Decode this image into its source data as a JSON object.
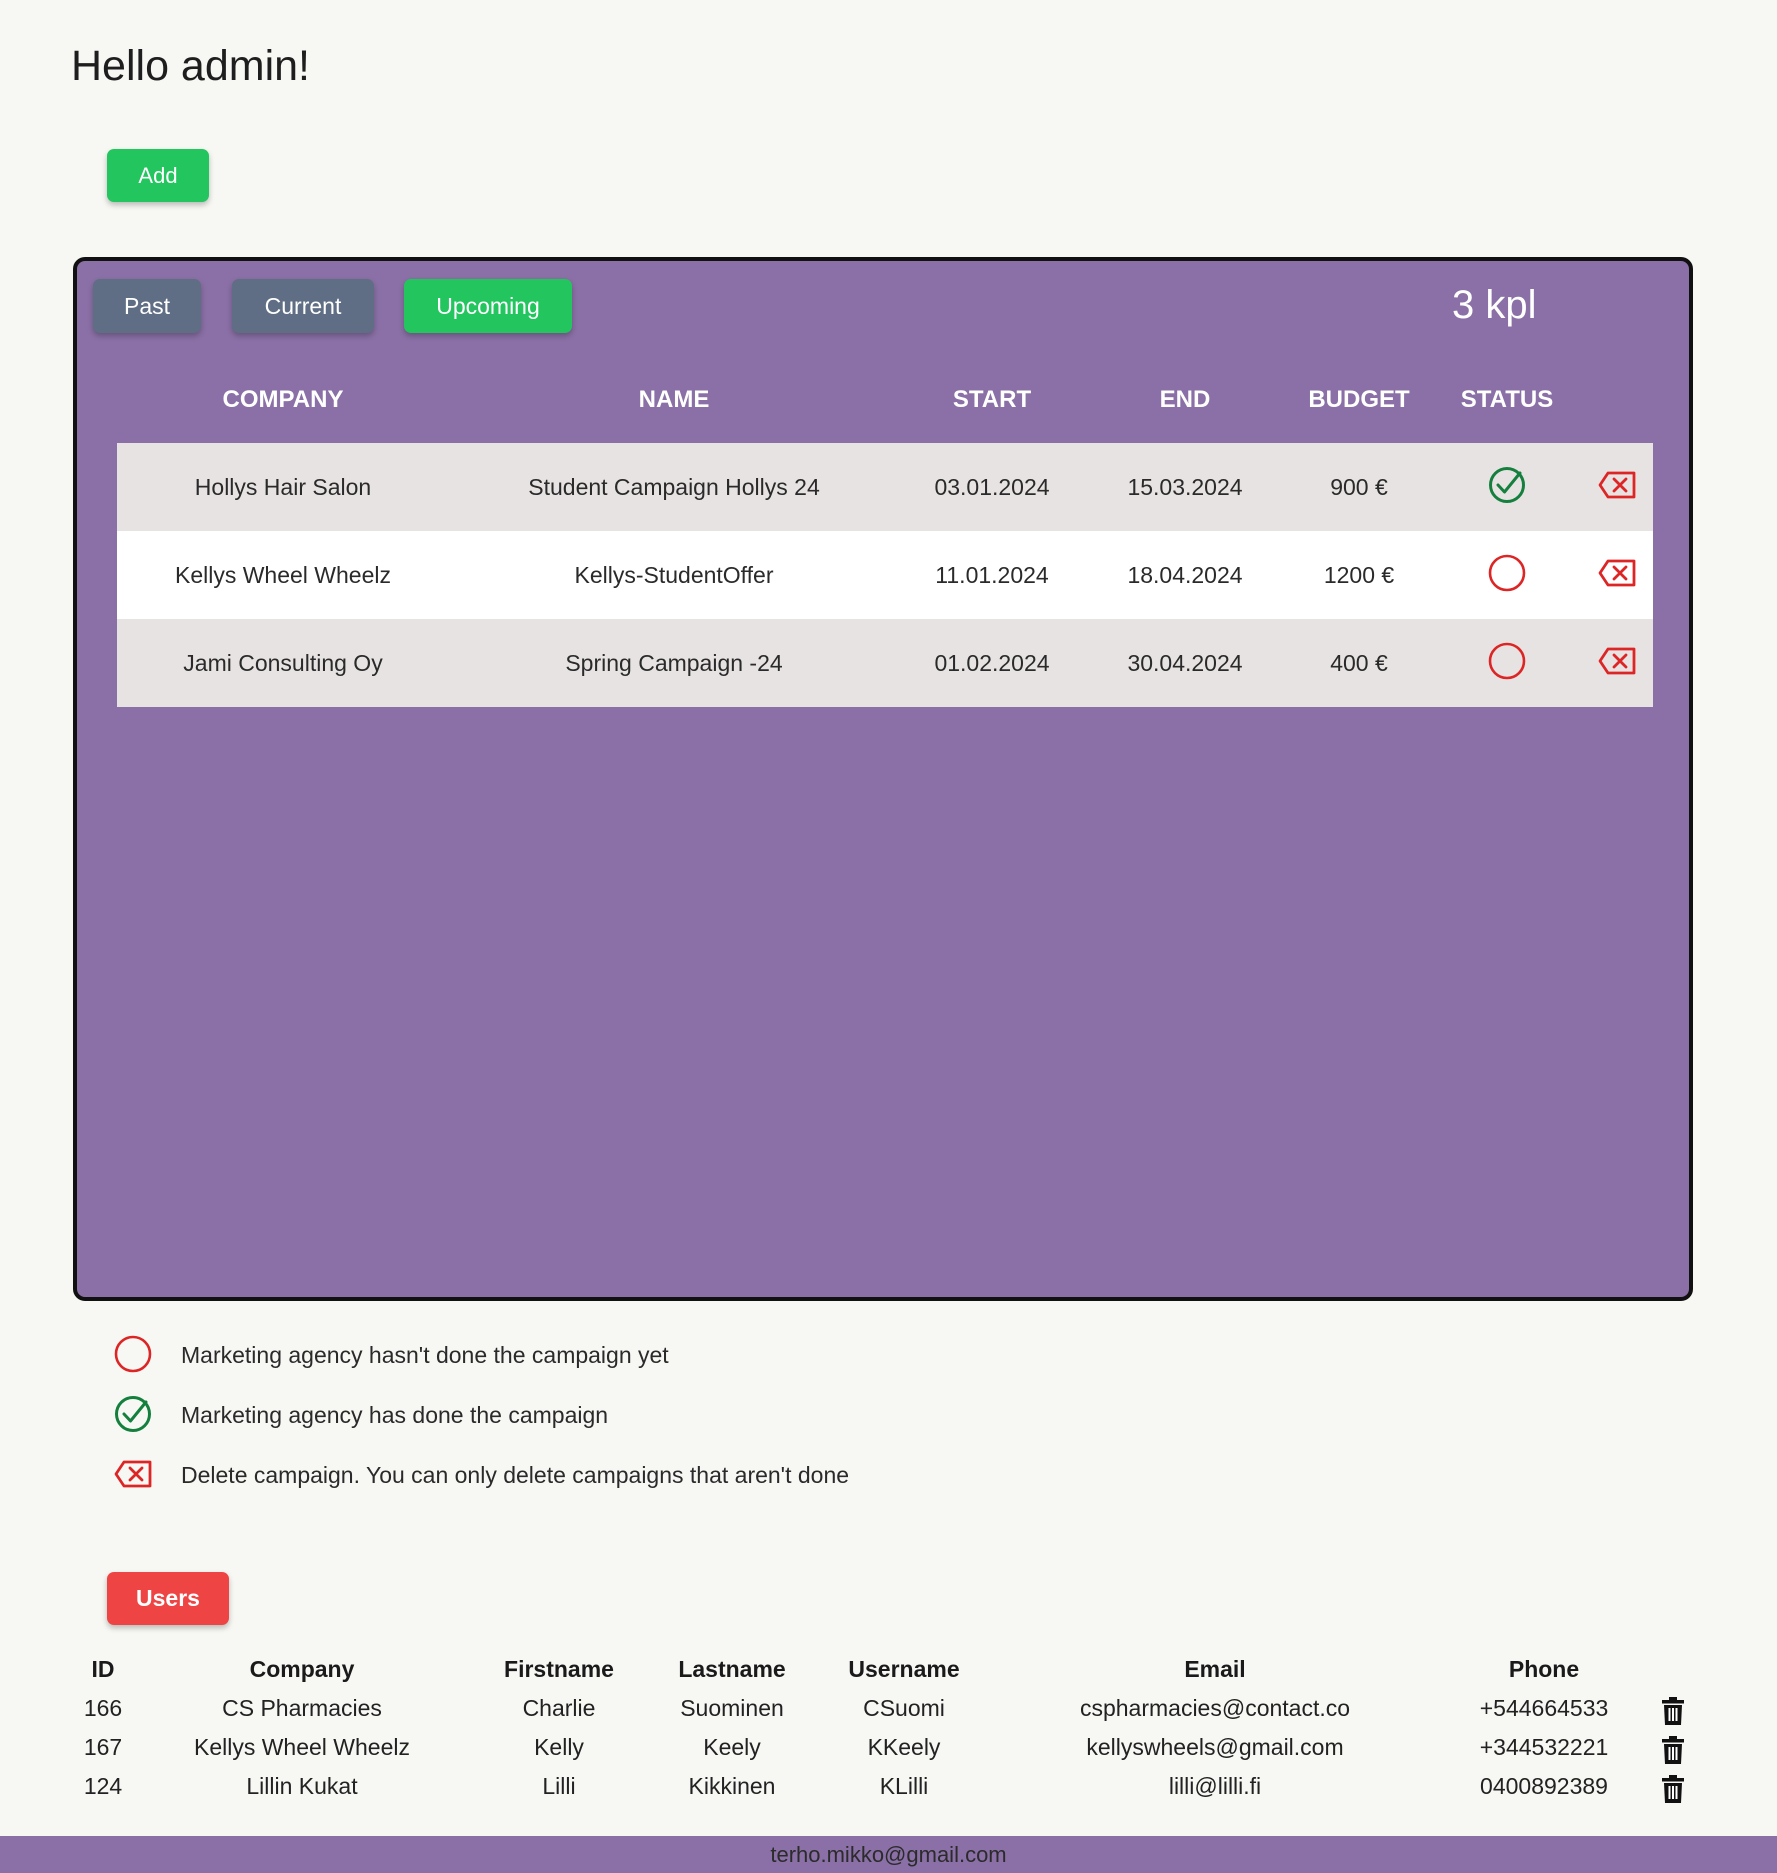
{
  "greeting": "Hello admin!",
  "add_button": "Add",
  "tabs": {
    "past": "Past",
    "current": "Current",
    "upcoming": "Upcoming",
    "active": "upcoming"
  },
  "count": "3 kpl",
  "campaign_headers": {
    "company": "COMPANY",
    "name": "NAME",
    "start": "START",
    "end": "END",
    "budget": "BUDGET",
    "status": "STATUS"
  },
  "campaigns": [
    {
      "company": "Hollys Hair Salon",
      "name": "Student Campaign Hollys 24",
      "start": "03.01.2024",
      "end": "15.03.2024",
      "budget": "900 €",
      "status": "done"
    },
    {
      "company": "Kellys Wheel Wheelz",
      "name": "Kellys-StudentOffer",
      "start": "11.01.2024",
      "end": "18.04.2024",
      "budget": "1200 €",
      "status": "not-done"
    },
    {
      "company": "Jami Consulting Oy",
      "name": "Spring Campaign -24",
      "start": "01.02.2024",
      "end": "30.04.2024",
      "budget": "400 €",
      "status": "not-done"
    }
  ],
  "legend": {
    "not_done": "Marketing agency hasn't done the campaign yet",
    "done": "Marketing agency has done the campaign",
    "delete": "Delete campaign. You can only delete campaigns that aren't done"
  },
  "users_button": "Users",
  "user_headers": {
    "id": "ID",
    "company": "Company",
    "firstname": "Firstname",
    "lastname": "Lastname",
    "username": "Username",
    "email": "Email",
    "phone": "Phone"
  },
  "users": [
    {
      "id": "166",
      "company": "CS Pharmacies",
      "firstname": "Charlie",
      "lastname": "Suominen",
      "username": "CSuomi",
      "email": "cspharmacies@contact.co",
      "phone": "+544664533"
    },
    {
      "id": "167",
      "company": "Kellys Wheel Wheelz",
      "firstname": "Kelly",
      "lastname": "Keely",
      "username": "KKeely",
      "email": "kellyswheels@gmail.com",
      "phone": "+344532221"
    },
    {
      "id": "124",
      "company": "Lillin Kukat",
      "firstname": "Lilli",
      "lastname": "Kikkinen",
      "username": "KLilli",
      "email": "lilli@lilli.fi",
      "phone": "0400892389"
    }
  ],
  "footer_email": "terho.mikko@gmail.com",
  "colors": {
    "panel": "#8a70a6",
    "accent_green": "#22c55e",
    "danger_red": "#ef4444",
    "tab_gray": "#5f6e84",
    "done_green": "#15803d",
    "not_done_red": "#dc2626"
  },
  "icons": {
    "done": "check-circle-icon",
    "not_done": "empty-circle-icon",
    "delete": "delete-x-icon",
    "user_delete": "trash-icon"
  }
}
